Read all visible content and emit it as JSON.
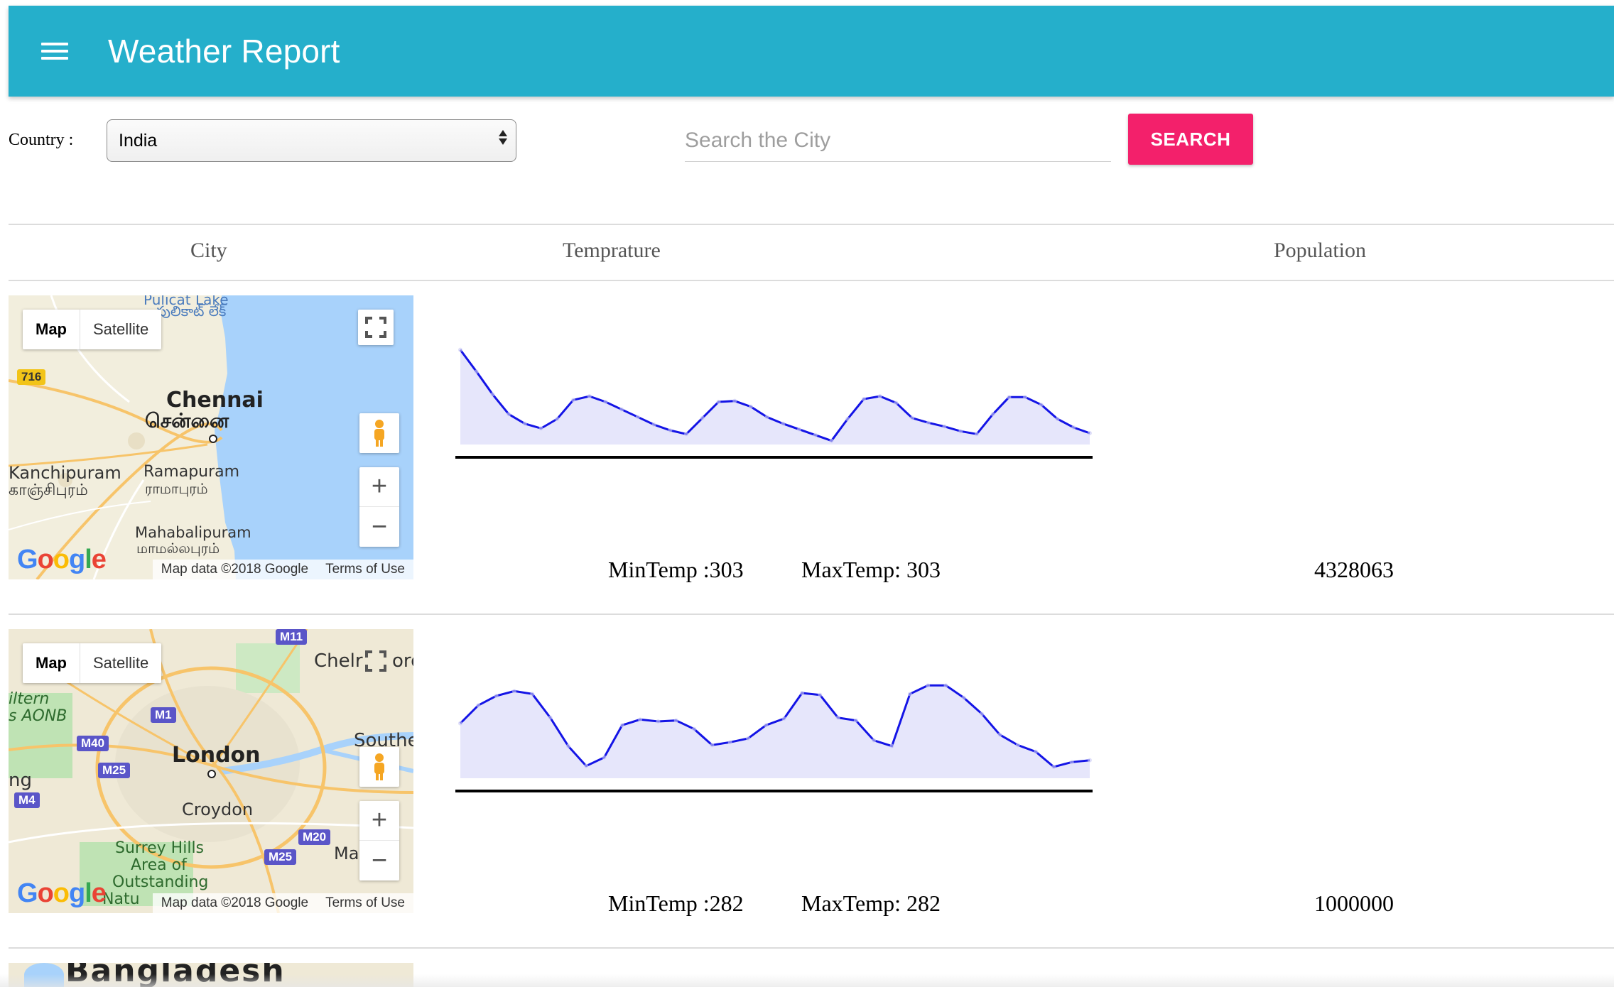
{
  "header": {
    "title": "Weather Report"
  },
  "filters": {
    "country_label": "Country :",
    "country_value": "India",
    "search_placeholder": "Search the City",
    "search_button": "SEARCH"
  },
  "table": {
    "headers": {
      "city": "City",
      "temperature": "Temprature",
      "population": "Population"
    },
    "rows": [
      {
        "map": {
          "map_tab": "Map",
          "satellite_tab": "Satellite",
          "labels": [
            "Pulicat Lake",
            "పులికాట్ లేక్",
            "Chennai",
            "சென்னை",
            "Kanchipuram",
            "காஞ்சிபுரம்",
            "Ramapuram",
            "ராமாபுரம்",
            "Mahabalipuram",
            "மாமல்லபுரம்"
          ],
          "road_badges": [
            "716"
          ],
          "attribution": "Map data ©2018 Google",
          "terms": "Terms of Use"
        },
        "min_temp": "MinTemp :303",
        "max_temp": "MaxTemp: 303",
        "population": "4328063"
      },
      {
        "map": {
          "map_tab": "Map",
          "satellite_tab": "Satellite",
          "labels": [
            "Chelr",
            "ord",
            "iltern",
            "s AONB",
            "London",
            "Southe",
            "ng",
            "Croydon",
            "Surrey Hills",
            "Area of",
            "Outstanding",
            "Natu",
            "Ma"
          ],
          "road_badges": [
            "M11",
            "M1",
            "M40",
            "M25",
            "M4",
            "M20",
            "M25"
          ],
          "attribution": "Map data ©2018 Google",
          "terms": "Terms of Use"
        },
        "min_temp": "MinTemp :282",
        "max_temp": "MaxTemp: 282",
        "population": "1000000"
      },
      {
        "map": {
          "labels": [
            "Bangladesh"
          ]
        }
      }
    ]
  },
  "chart_data": [
    {
      "type": "area",
      "title": "",
      "x": [
        1,
        2,
        3,
        4,
        5,
        6,
        7,
        8,
        9,
        10,
        11,
        12,
        13,
        14,
        15,
        16,
        17,
        18,
        19,
        20,
        21,
        22,
        23,
        24,
        25,
        26,
        27,
        28,
        29,
        30,
        31,
        32,
        33,
        34,
        35,
        36
      ],
      "values": [
        100,
        77,
        53,
        32,
        22,
        17,
        27,
        47,
        51,
        45,
        37,
        29,
        21,
        15,
        11,
        28,
        45,
        46,
        40,
        29,
        22,
        16,
        10,
        4,
        27,
        48,
        51,
        44,
        28,
        23,
        19,
        14,
        11,
        32,
        50,
        50,
        42,
        27,
        18,
        12
      ],
      "ylim": [
        0,
        105
      ],
      "fill": "#e6e6fb",
      "stroke": "#1414e6",
      "axis_color": "#000000"
    },
    {
      "type": "area",
      "title": "",
      "x": [
        1,
        2,
        3,
        4,
        5,
        6,
        7,
        8,
        9,
        10,
        11,
        12,
        13,
        14,
        15,
        16,
        17,
        18,
        19,
        20,
        21,
        22,
        23,
        24,
        25,
        26,
        27,
        28,
        29,
        30,
        31,
        32,
        33,
        34,
        35,
        36
      ],
      "values": [
        58,
        77,
        87,
        92,
        89,
        64,
        34,
        13,
        22,
        56,
        62,
        60,
        61,
        52,
        35,
        38,
        42,
        56,
        63,
        90,
        88,
        64,
        61,
        40,
        34,
        89,
        98,
        98,
        85,
        68,
        46,
        35,
        28,
        12,
        17,
        19
      ],
      "ylim": [
        0,
        105
      ],
      "fill": "#e6e6fb",
      "stroke": "#1414e6",
      "axis_color": "#000000"
    }
  ],
  "colors": {
    "appbar": "#25afcb",
    "search_button": "#f3206b",
    "map_water": "#a8d2fb",
    "map_land": "#f2eedd",
    "road_badge": "#6a5acd"
  },
  "icons": [
    "menu-icon",
    "fullscreen-icon",
    "pegman-icon",
    "zoom-in-icon",
    "zoom-out-icon",
    "google-logo"
  ]
}
